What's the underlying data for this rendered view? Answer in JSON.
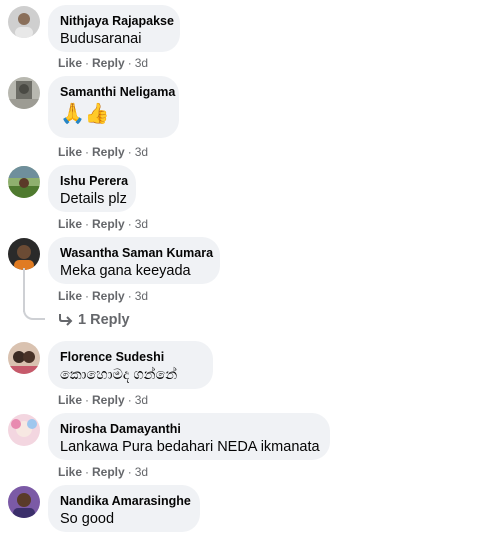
{
  "actions": {
    "like": "Like",
    "reply": "Reply",
    "dot": "·"
  },
  "comments": [
    {
      "author": "Nithjaya Rajapakse",
      "text": "Budusaranai",
      "time": "3d"
    },
    {
      "author": "Samanthi Neligama",
      "text": "🙏👍",
      "time": "3d"
    },
    {
      "author": "Ishu Perera",
      "text": "Details plz",
      "time": "3d"
    },
    {
      "author": "Wasantha Saman Kumara",
      "text": "Meka gana keeyada",
      "time": "3d"
    },
    {
      "author": "Florence Sudeshi",
      "text": "කොහොමද ගන්නේ",
      "time": "3d"
    },
    {
      "author": "Nirosha Damayanthi",
      "text": "Lankawa Pura bedahari NEDA ikmanata",
      "time": "3d"
    },
    {
      "author": "Nandika Amarasinghe",
      "text": "So good",
      "time": ""
    }
  ],
  "view_replies": "1 Reply",
  "icons": {
    "reply_arrow": "reply-arrow-icon"
  },
  "colors": {
    "bubble": "#f0f2f5",
    "meta": "#65676b",
    "text": "#050505"
  }
}
